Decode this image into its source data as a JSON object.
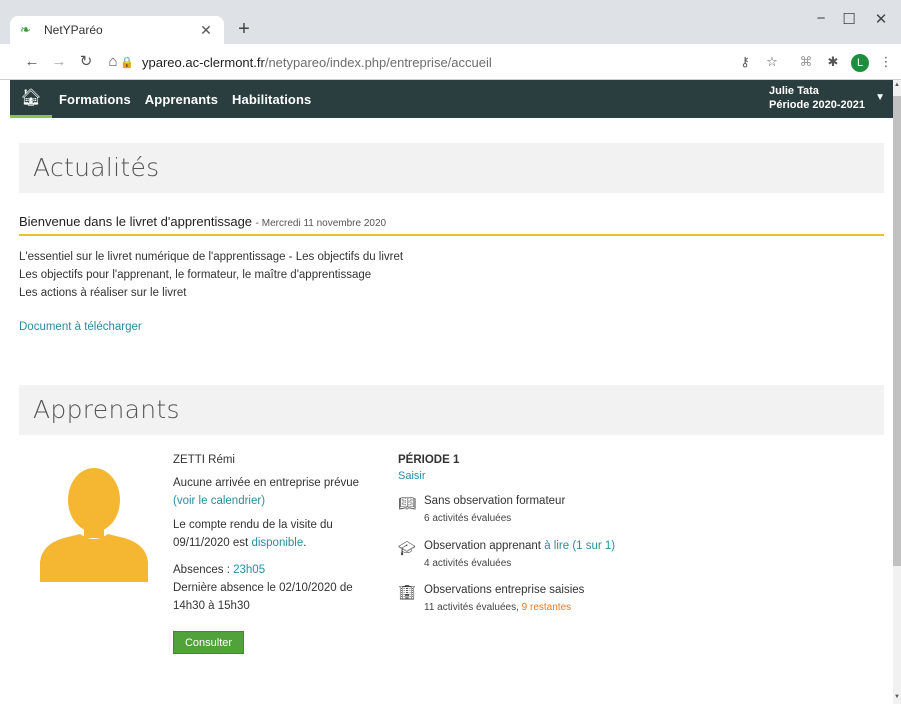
{
  "browser": {
    "tab_title": "NetYParéo",
    "url_host": "ypareo.ac-clermont.fr",
    "url_path": "/netypareo/index.php/entreprise/accueil",
    "profile_initial": "L"
  },
  "nav": {
    "items": [
      "Formations",
      "Apprenants",
      "Habilitations"
    ],
    "user_name": "Julie Tata",
    "period": "Période 2020-2021"
  },
  "actualites": {
    "heading": "Actualités",
    "article_title": "Bienvenue dans le livret d'apprentissage",
    "article_date": "- Mercredi 11 novembre 2020",
    "lines": [
      "L'essentiel sur le livret numérique de l'apprentissage - Les objectifs du livret",
      "Les objectifs pour l'apprenant, le formateur, le maître d'apprentissage",
      "Les actions à réaliser sur le livret"
    ],
    "download_link": "Document à télécharger"
  },
  "apprenants": {
    "heading": "Apprenants",
    "name": "ZETTI Rémi",
    "arrival_text": "Aucune arrivée en entreprise prévue",
    "calendar_link": "(voir le calendrier)",
    "report_text_1": "Le compte rendu de la visite du",
    "report_text_2": "09/11/2020 est",
    "report_link": "disponible",
    "absences_label": "Absences :",
    "absences_value": "23h05",
    "last_absence_1": "Dernière absence le 02/10/2020 de",
    "last_absence_2": "14h30 à 15h30",
    "button": "Consulter",
    "period_title": "PÉRIODE 1",
    "period_link": "Saisir",
    "obs": [
      {
        "title": "Sans observation formateur",
        "sub": "6 activités évaluées"
      },
      {
        "title": "Observation apprenant",
        "link": "à lire (1 sur 1)",
        "sub": "4 activités évaluées"
      },
      {
        "title": "Observations entreprise saisies",
        "sub": "11 activités évaluées,",
        "sub_link": "9 restantes"
      }
    ]
  }
}
